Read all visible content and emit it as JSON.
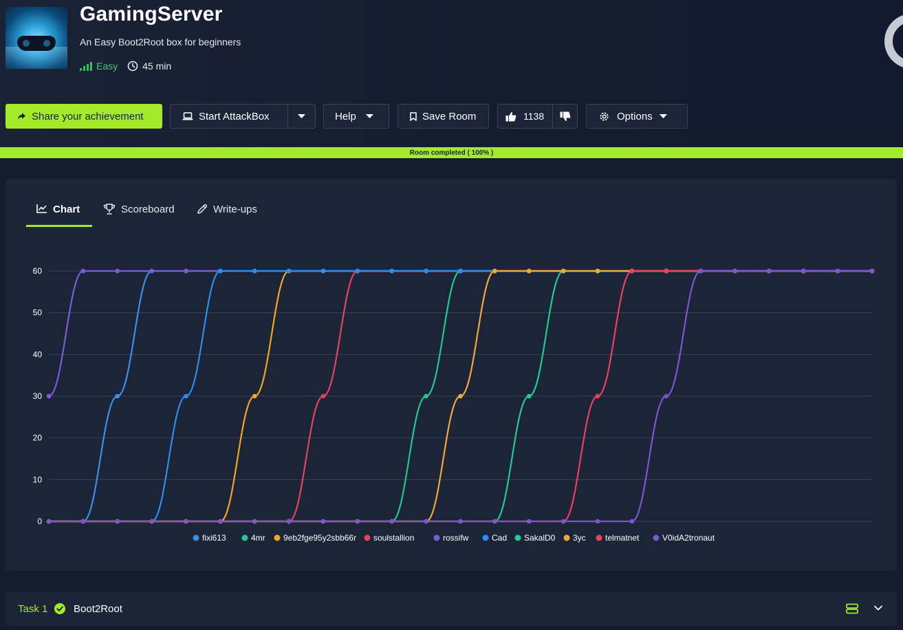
{
  "room": {
    "title": "GamingServer",
    "subtitle": "An Easy Boot2Root box for beginners",
    "difficulty": "Easy",
    "duration": "45 min"
  },
  "toolbar": {
    "share_label": "Share your achievement",
    "attackbox_label": "Start AttackBox",
    "help_label": "Help",
    "save_label": "Save Room",
    "likes_count": "1138",
    "options_label": "Options"
  },
  "progress": {
    "label": "Room completed ( 100% )",
    "value": 100
  },
  "tabs": [
    {
      "label": "Chart",
      "active": true,
      "icon": "line-chart-icon"
    },
    {
      "label": "Scoreboard",
      "active": false,
      "icon": "trophy-icon"
    },
    {
      "label": "Write-ups",
      "active": false,
      "icon": "pencil-icon"
    }
  ],
  "chart_data": {
    "type": "line",
    "ylim": [
      0,
      60
    ],
    "yticks": [
      0,
      10,
      20,
      30,
      40,
      50,
      60
    ],
    "x_count": 25,
    "legend_position": "bottom",
    "grid": true,
    "series": [
      {
        "name": "fixi613",
        "color": "#3b8fe8",
        "points": [
          [
            0,
            0
          ],
          [
            1,
            0
          ],
          [
            2,
            30
          ],
          [
            3,
            60
          ],
          [
            4,
            60
          ],
          [
            5,
            60
          ],
          [
            6,
            60
          ],
          [
            7,
            60
          ],
          [
            8,
            60
          ],
          [
            9,
            60
          ],
          [
            10,
            60
          ],
          [
            11,
            60
          ],
          [
            12,
            60
          ],
          [
            13,
            60
          ],
          [
            14,
            60
          ],
          [
            15,
            60
          ],
          [
            16,
            60
          ],
          [
            17,
            60
          ],
          [
            18,
            60
          ],
          [
            19,
            60
          ],
          [
            20,
            60
          ],
          [
            21,
            60
          ],
          [
            22,
            60
          ],
          [
            23,
            60
          ],
          [
            24,
            60
          ]
        ]
      },
      {
        "name": "4mr",
        "color": "#22c98a",
        "points": [
          [
            0,
            0
          ],
          [
            1,
            0
          ],
          [
            2,
            0
          ],
          [
            3,
            0
          ],
          [
            4,
            0
          ],
          [
            5,
            0
          ],
          [
            6,
            0
          ],
          [
            7,
            0
          ],
          [
            8,
            0
          ],
          [
            9,
            0
          ],
          [
            10,
            0
          ],
          [
            11,
            30
          ],
          [
            12,
            60
          ],
          [
            13,
            60
          ],
          [
            14,
            60
          ],
          [
            15,
            60
          ],
          [
            16,
            60
          ],
          [
            17,
            60
          ],
          [
            18,
            60
          ],
          [
            19,
            60
          ],
          [
            20,
            60
          ],
          [
            21,
            60
          ],
          [
            22,
            60
          ],
          [
            23,
            60
          ],
          [
            24,
            60
          ]
        ]
      },
      {
        "name": "9eb2fge95y2sbb66r",
        "color": "#f5a524",
        "points": [
          [
            0,
            0
          ],
          [
            1,
            0
          ],
          [
            2,
            0
          ],
          [
            3,
            0
          ],
          [
            4,
            0
          ],
          [
            5,
            0
          ],
          [
            6,
            30
          ],
          [
            7,
            60
          ],
          [
            8,
            60
          ],
          [
            9,
            60
          ],
          [
            10,
            60
          ],
          [
            11,
            60
          ],
          [
            12,
            60
          ],
          [
            13,
            60
          ],
          [
            14,
            60
          ],
          [
            15,
            60
          ],
          [
            16,
            60
          ],
          [
            17,
            60
          ],
          [
            18,
            60
          ],
          [
            19,
            60
          ],
          [
            20,
            60
          ],
          [
            21,
            60
          ],
          [
            22,
            60
          ],
          [
            23,
            60
          ],
          [
            24,
            60
          ]
        ]
      },
      {
        "name": "soulstallion",
        "color": "#e8415a",
        "points": [
          [
            0,
            0
          ],
          [
            1,
            0
          ],
          [
            2,
            0
          ],
          [
            3,
            0
          ],
          [
            4,
            0
          ],
          [
            5,
            0
          ],
          [
            6,
            0
          ],
          [
            7,
            0
          ],
          [
            8,
            30
          ],
          [
            9,
            60
          ],
          [
            10,
            60
          ],
          [
            11,
            60
          ],
          [
            12,
            60
          ],
          [
            13,
            60
          ],
          [
            14,
            60
          ],
          [
            15,
            60
          ],
          [
            16,
            60
          ],
          [
            17,
            60
          ],
          [
            18,
            60
          ],
          [
            19,
            60
          ],
          [
            20,
            60
          ],
          [
            21,
            60
          ],
          [
            22,
            60
          ],
          [
            23,
            60
          ],
          [
            24,
            60
          ]
        ]
      },
      {
        "name": "rossifw",
        "color": "#7c5cd6",
        "points": [
          [
            0,
            30
          ],
          [
            1,
            60
          ],
          [
            2,
            60
          ],
          [
            3,
            60
          ],
          [
            4,
            60
          ],
          [
            5,
            60
          ],
          [
            6,
            60
          ],
          [
            7,
            60
          ],
          [
            8,
            60
          ],
          [
            9,
            60
          ],
          [
            10,
            60
          ],
          [
            11,
            60
          ],
          [
            12,
            60
          ],
          [
            13,
            60
          ],
          [
            14,
            60
          ],
          [
            15,
            60
          ],
          [
            16,
            60
          ],
          [
            17,
            60
          ],
          [
            18,
            60
          ],
          [
            19,
            60
          ],
          [
            20,
            60
          ],
          [
            21,
            60
          ],
          [
            22,
            60
          ],
          [
            23,
            60
          ],
          [
            24,
            60
          ]
        ]
      },
      {
        "name": "Cad",
        "color": "#2a8ff0",
        "points": [
          [
            0,
            0
          ],
          [
            1,
            0
          ],
          [
            2,
            0
          ],
          [
            3,
            0
          ],
          [
            4,
            30
          ],
          [
            5,
            60
          ],
          [
            6,
            60
          ],
          [
            7,
            60
          ],
          [
            8,
            60
          ],
          [
            9,
            60
          ],
          [
            10,
            60
          ],
          [
            11,
            60
          ],
          [
            12,
            60
          ],
          [
            13,
            60
          ],
          [
            14,
            60
          ],
          [
            15,
            60
          ],
          [
            16,
            60
          ],
          [
            17,
            60
          ],
          [
            18,
            60
          ],
          [
            19,
            60
          ],
          [
            20,
            60
          ],
          [
            21,
            60
          ],
          [
            22,
            60
          ],
          [
            23,
            60
          ],
          [
            24,
            60
          ]
        ]
      },
      {
        "name": "SakalD0",
        "color": "#1fce8e",
        "points": [
          [
            0,
            0
          ],
          [
            1,
            0
          ],
          [
            2,
            0
          ],
          [
            3,
            0
          ],
          [
            4,
            0
          ],
          [
            5,
            0
          ],
          [
            6,
            0
          ],
          [
            7,
            0
          ],
          [
            8,
            0
          ],
          [
            9,
            0
          ],
          [
            10,
            0
          ],
          [
            11,
            0
          ],
          [
            12,
            0
          ],
          [
            13,
            0
          ],
          [
            14,
            30
          ],
          [
            15,
            60
          ],
          [
            16,
            60
          ],
          [
            17,
            60
          ],
          [
            18,
            60
          ],
          [
            19,
            60
          ],
          [
            20,
            60
          ],
          [
            21,
            60
          ],
          [
            22,
            60
          ],
          [
            23,
            60
          ],
          [
            24,
            60
          ]
        ]
      },
      {
        "name": "3yc",
        "color": "#f2a93b",
        "points": [
          [
            0,
            0
          ],
          [
            1,
            0
          ],
          [
            2,
            0
          ],
          [
            3,
            0
          ],
          [
            4,
            0
          ],
          [
            5,
            0
          ],
          [
            6,
            0
          ],
          [
            7,
            0
          ],
          [
            8,
            0
          ],
          [
            9,
            0
          ],
          [
            10,
            0
          ],
          [
            11,
            0
          ],
          [
            12,
            30
          ],
          [
            13,
            60
          ],
          [
            14,
            60
          ],
          [
            15,
            60
          ],
          [
            16,
            60
          ],
          [
            17,
            60
          ],
          [
            18,
            60
          ],
          [
            19,
            60
          ],
          [
            20,
            60
          ],
          [
            21,
            60
          ],
          [
            22,
            60
          ],
          [
            23,
            60
          ],
          [
            24,
            60
          ]
        ]
      },
      {
        "name": "telmatnet",
        "color": "#ee3f5c",
        "points": [
          [
            0,
            0
          ],
          [
            1,
            0
          ],
          [
            2,
            0
          ],
          [
            3,
            0
          ],
          [
            4,
            0
          ],
          [
            5,
            0
          ],
          [
            6,
            0
          ],
          [
            7,
            0
          ],
          [
            8,
            0
          ],
          [
            9,
            0
          ],
          [
            10,
            0
          ],
          [
            11,
            0
          ],
          [
            12,
            0
          ],
          [
            13,
            0
          ],
          [
            14,
            0
          ],
          [
            15,
            0
          ],
          [
            16,
            30
          ],
          [
            17,
            60
          ],
          [
            18,
            60
          ],
          [
            19,
            60
          ],
          [
            20,
            60
          ],
          [
            21,
            60
          ],
          [
            22,
            60
          ],
          [
            23,
            60
          ],
          [
            24,
            60
          ]
        ]
      },
      {
        "name": "V0idA2tronaut",
        "color": "#7a55d4",
        "points": [
          [
            0,
            0
          ],
          [
            1,
            0
          ],
          [
            2,
            0
          ],
          [
            3,
            0
          ],
          [
            4,
            0
          ],
          [
            5,
            0
          ],
          [
            6,
            0
          ],
          [
            7,
            0
          ],
          [
            8,
            0
          ],
          [
            9,
            0
          ],
          [
            10,
            0
          ],
          [
            11,
            0
          ],
          [
            12,
            0
          ],
          [
            13,
            0
          ],
          [
            14,
            0
          ],
          [
            15,
            0
          ],
          [
            16,
            0
          ],
          [
            17,
            0
          ],
          [
            18,
            30
          ],
          [
            19,
            60
          ],
          [
            20,
            60
          ],
          [
            21,
            60
          ],
          [
            22,
            60
          ],
          [
            23,
            60
          ],
          [
            24,
            60
          ]
        ]
      }
    ]
  },
  "task": {
    "number_label": "Task 1",
    "title": "Boot2Root"
  },
  "colors": {
    "accent": "#a3ea2a",
    "panel": "#1c2538",
    "background": "#141b2b"
  }
}
